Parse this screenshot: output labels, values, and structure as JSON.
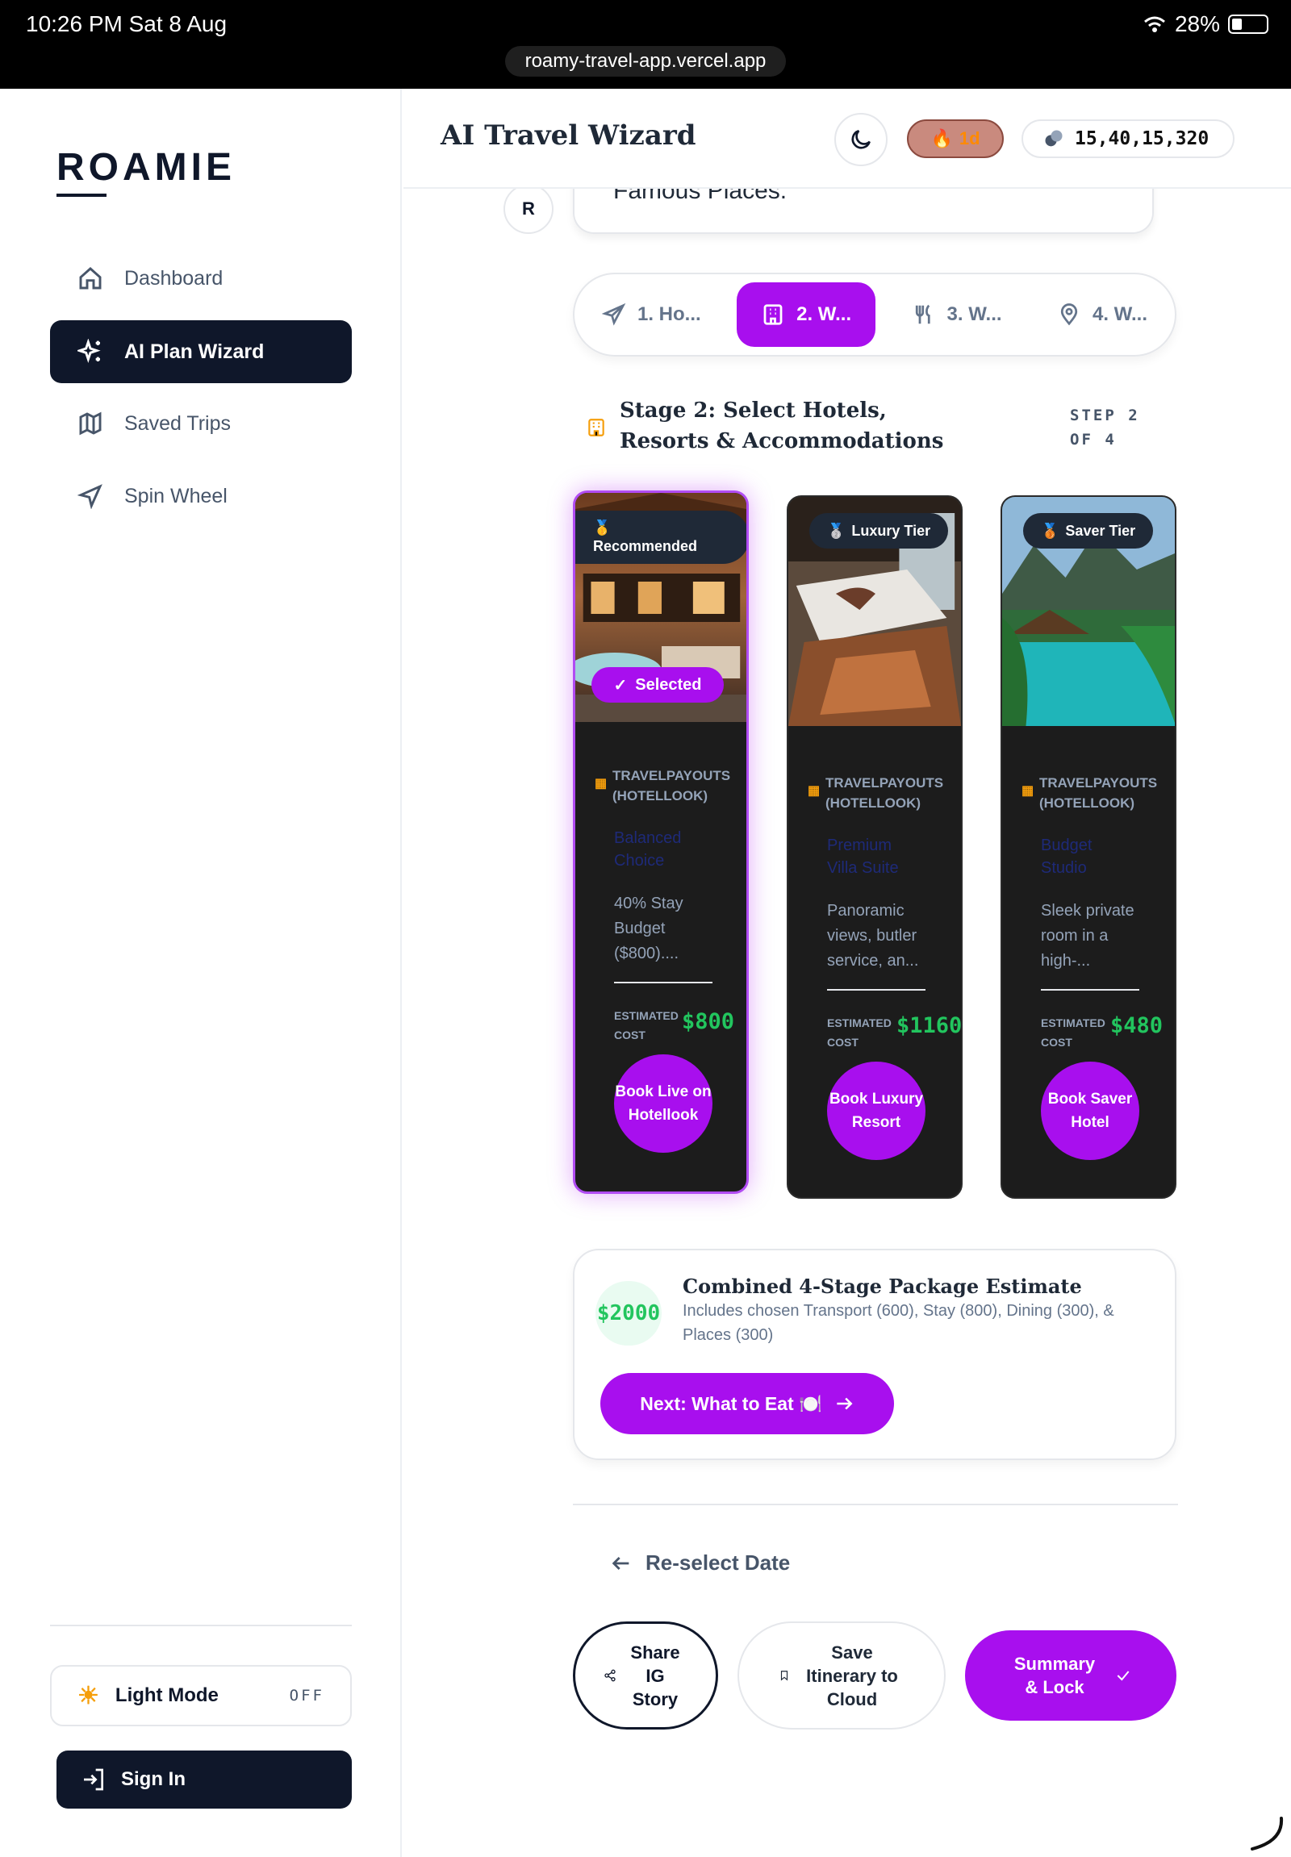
{
  "status_bar": {
    "time": "10:26 PM  Sat 8 Aug",
    "battery": "28%",
    "url": "roamy-travel-app.vercel.app"
  },
  "sidebar": {
    "logo": "ROAMIE",
    "items": [
      {
        "label": "Dashboard"
      },
      {
        "label": "AI Plan Wizard"
      },
      {
        "label": "Saved Trips"
      },
      {
        "label": "Spin Wheel"
      }
    ],
    "light_mode": {
      "label": "Light Mode",
      "state": "OFF"
    },
    "sign_in": "Sign In"
  },
  "header": {
    "title": "AI Travel Wizard",
    "streak": "1d",
    "credits": "15,40,15,320"
  },
  "chat": {
    "avatar": "R",
    "text": "Famous Places."
  },
  "stages": [
    {
      "label": "1. Ho..."
    },
    {
      "label": "2. W..."
    },
    {
      "label": "3. W..."
    },
    {
      "label": "4. W..."
    }
  ],
  "stage": {
    "title": "Stage 2: Select Hotels, Resorts & Accommodations",
    "step": "STEP 2 OF 4"
  },
  "hotels": [
    {
      "tier": "Recommended",
      "selected": "Selected",
      "source": "TRAVELPAYOUTS (HOTELLOOK)",
      "name": "Balanced Choice",
      "desc": "40% Stay Budget ($800)....",
      "est_label": "ESTIMATED COST",
      "price": "$800",
      "book": "Book Live on Hotellook"
    },
    {
      "tier": "Luxury Tier",
      "source": "TRAVELPAYOUTS (HOTELLOOK)",
      "name": "Premium Villa Suite",
      "desc": "Panoramic views, butler service, an...",
      "est_label": "ESTIMATED COST",
      "price": "$1160",
      "book": "Book Luxury Resort"
    },
    {
      "tier": "Saver Tier",
      "source": "TRAVELPAYOUTS (HOTELLOOK)",
      "name": "Budget Studio",
      "desc": "Sleek private room in a high-...",
      "est_label": "ESTIMATED COST",
      "price": "$480",
      "book": "Book Saver Hotel"
    }
  ],
  "package": {
    "total": "$2000",
    "title": "Combined 4-Stage Package Estimate",
    "desc": "Includes chosen Transport (600), Stay (800), Dining (300), & Places (300)",
    "next": "Next: What to Eat 🍽️"
  },
  "footer": {
    "reselect": "Re-select Date",
    "share": "Share IG Story",
    "save": "Save Itinerary to Cloud",
    "summary": "Summary & Lock"
  },
  "colors": {
    "accent": "#a80fee",
    "navy": "#0f172a",
    "price_green": "#22c55e",
    "amber": "#f59e0b"
  }
}
